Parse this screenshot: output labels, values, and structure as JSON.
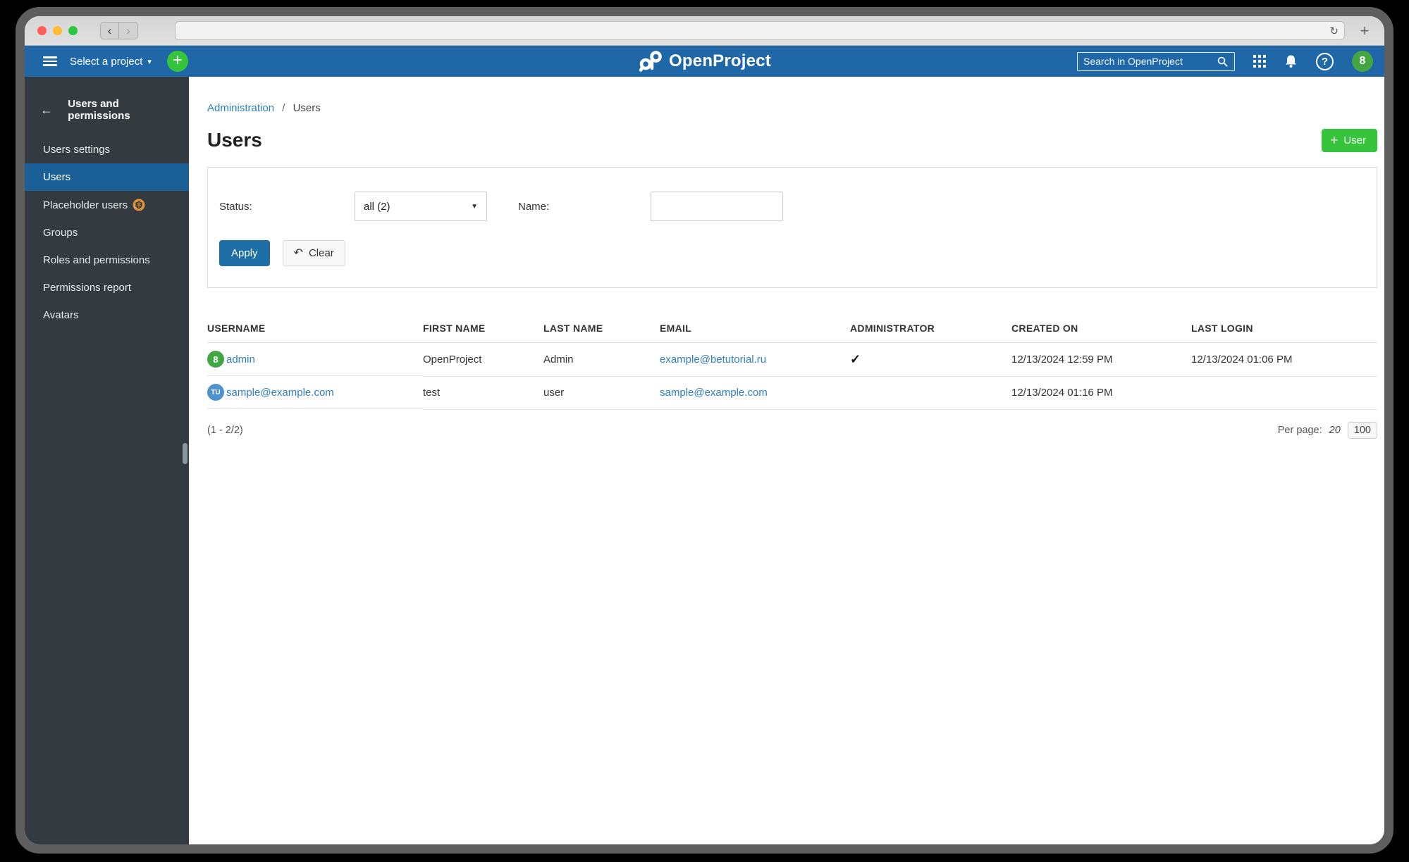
{
  "colors": {
    "header_blue": "#1f67a7",
    "sidebar_bg": "#333a40",
    "sidebar_active": "#1a6096",
    "link": "#2f80c0",
    "green": "#36c43d",
    "apply_blue": "#1d6fa5",
    "avatar_green": "#44a544",
    "avatar_blue": "#4f93ce",
    "badge_orange": "#e0923f"
  },
  "browser": {
    "url": "",
    "back_glyph": "‹",
    "forward_glyph": "›",
    "reload_glyph": "↻",
    "newtab_glyph": "+"
  },
  "app_header": {
    "select_project_label": "Select a project",
    "select_caret_glyph": "▾",
    "add_project_glyph": "+",
    "logo_text": "OpenProject",
    "search_placeholder": "Search in OpenProject",
    "help_glyph": "?",
    "avatar_text": "8"
  },
  "sidebar": {
    "back_glyph": "←",
    "title": "Users and permissions",
    "items": [
      {
        "label": "Users settings"
      },
      {
        "label": "Users"
      },
      {
        "label": "Placeholder users"
      },
      {
        "label": "Groups"
      },
      {
        "label": "Roles and permissions"
      },
      {
        "label": "Permissions report"
      },
      {
        "label": "Avatars"
      }
    ]
  },
  "breadcrumb": {
    "parent": "Administration",
    "separator": "/",
    "current": "Users"
  },
  "page": {
    "title": "Users",
    "add_user_plus_glyph": "+",
    "add_user_label": "User"
  },
  "filters": {
    "status_label": "Status:",
    "status_value": "all (2)",
    "status_caret_glyph": "▼",
    "name_label": "Name:",
    "name_value": "",
    "apply_label": "Apply",
    "clear_undo_glyph": "↶",
    "clear_label": "Clear"
  },
  "table": {
    "headers": {
      "username": "USERNAME",
      "first_name": "FIRST NAME",
      "last_name": "LAST NAME",
      "email": "EMAIL",
      "administrator": "ADMINISTRATOR",
      "created_on": "CREATED ON",
      "last_login": "LAST LOGIN"
    },
    "rows": [
      {
        "avatar_text": "8",
        "username": "admin",
        "first_name": "OpenProject",
        "last_name": "Admin",
        "email": "example@betutorial.ru",
        "admin_mark": "✓",
        "created_on": "12/13/2024 12:59 PM",
        "last_login": "12/13/2024 01:06 PM"
      },
      {
        "avatar_text": "TU",
        "username": "sample@example.com",
        "first_name": "test",
        "last_name": "user",
        "email": "sample@example.com",
        "admin_mark": "",
        "created_on": "12/13/2024 01:16 PM",
        "last_login": ""
      }
    ]
  },
  "pagination": {
    "range_text": "(1 - 2/2)",
    "per_page_label": "Per page:",
    "current": "20",
    "options": [
      "100"
    ]
  }
}
